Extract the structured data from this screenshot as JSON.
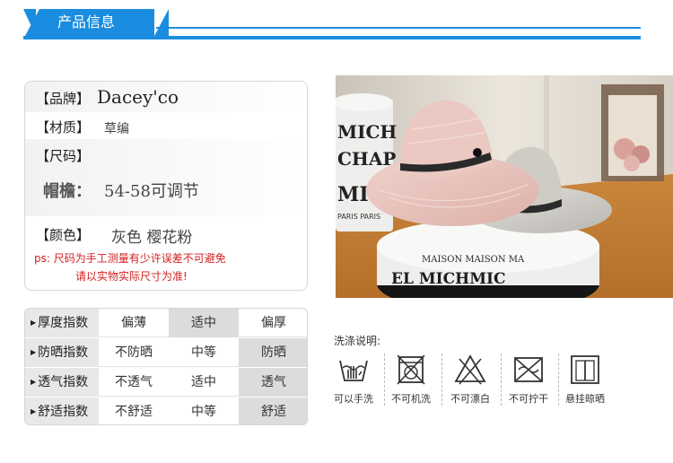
{
  "header": {
    "title": "产品信息"
  },
  "product_info": {
    "brand": {
      "label": "【品牌】",
      "value": "Dacey'co"
    },
    "material": {
      "label": "【材质】",
      "value": "草编"
    },
    "size": {
      "label": "【尺码】",
      "brim_label": "帽檐：",
      "brim_value": "54-58可调节"
    },
    "color": {
      "label": "【颜色】",
      "value": "灰色  樱花粉"
    },
    "note": {
      "line1": "ps: 尺码为手工测量有少许误差不可避免",
      "line2": "请以实物实际尺寸为准!"
    }
  },
  "photo": {
    "box_text_front": "MICHEL MAISON MAISON MAISON MARMI",
    "box_text_back": "MICHEL CHAPEAUX MICHEL"
  },
  "indices": [
    {
      "label": "厚度指数",
      "options": [
        "偏薄",
        "适中",
        "偏厚"
      ],
      "selected": 1
    },
    {
      "label": "防晒指数",
      "options": [
        "不防晒",
        "中等",
        "防晒"
      ],
      "selected": 2
    },
    {
      "label": "透气指数",
      "options": [
        "不透气",
        "适中",
        "透气"
      ],
      "selected": 2
    },
    {
      "label": "舒适指数",
      "options": [
        "不舒适",
        "中等",
        "舒适"
      ],
      "selected": 2
    }
  ],
  "wash": {
    "title": "洗涤说明:",
    "items": [
      {
        "icon": "hand-wash-icon",
        "label": "可以手洗"
      },
      {
        "icon": "no-machine-wash-icon",
        "label": "不可机洗"
      },
      {
        "icon": "no-bleach-icon",
        "label": "不可漂白"
      },
      {
        "icon": "no-wring-icon",
        "label": "不可拧干"
      },
      {
        "icon": "line-dry-icon",
        "label": "悬挂晾晒"
      }
    ]
  },
  "colors": {
    "accent": "#1a8de0",
    "note_red": "#d42020",
    "panel_gray": "#e8e8e8"
  }
}
